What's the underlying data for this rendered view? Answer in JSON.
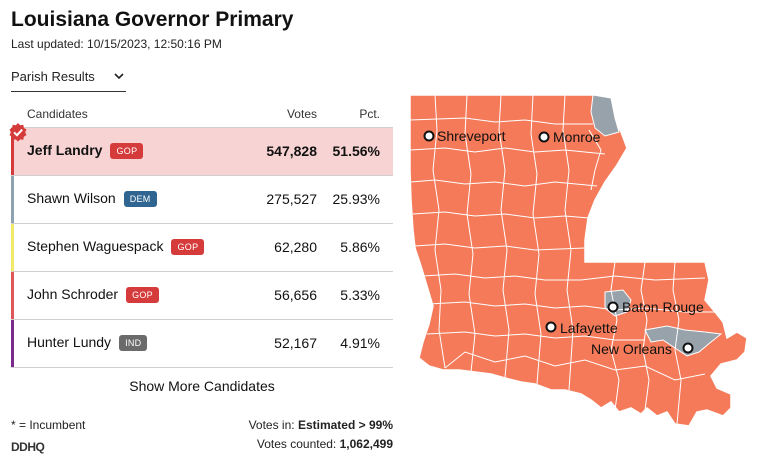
{
  "header": {
    "title": "Louisiana Governor Primary",
    "last_updated": "Last updated: 10/15/2023, 12:50:16 PM"
  },
  "view_selector": {
    "label": "Parish Results",
    "icon": "chevron-down-icon"
  },
  "table": {
    "headers": {
      "candidates": "Candidates",
      "votes": "Votes",
      "pct": "Pct."
    },
    "rows": [
      {
        "name": "Jeff Landry",
        "party": "GOP",
        "votes": "547,828",
        "pct": "51.56%",
        "party_color": "#d63b3b",
        "bar_color": "#d63b3b",
        "winner": true
      },
      {
        "name": "Shawn Wilson",
        "party": "DEM",
        "votes": "275,527",
        "pct": "25.93%",
        "party_color": "#2f6590",
        "bar_color": "#8fa2b0",
        "winner": false
      },
      {
        "name": "Stephen Waguespack",
        "party": "GOP",
        "votes": "62,280",
        "pct": "5.86%",
        "party_color": "#d63b3b",
        "bar_color": "#f2e968",
        "winner": false
      },
      {
        "name": "John Schroder",
        "party": "GOP",
        "votes": "56,656",
        "pct": "5.33%",
        "party_color": "#d63b3b",
        "bar_color": "#e0575a",
        "winner": false
      },
      {
        "name": "Hunter Lundy",
        "party": "IND",
        "votes": "52,167",
        "pct": "4.91%",
        "party_color": "#6b6b6b",
        "bar_color": "#7a2a8a",
        "winner": false
      }
    ],
    "show_more": "Show More Candidates"
  },
  "footer": {
    "incumbent_note": "* = Incumbent",
    "votes_in_label": "Votes in: ",
    "votes_in_value": "Estimated > 99%",
    "votes_counted_label": "Votes counted: ",
    "votes_counted_value": "1,062,499",
    "logo": "DDHQ"
  },
  "map": {
    "landry_color": "#f47a59",
    "wilson_color": "#97a2aa",
    "cities": [
      "Shreveport",
      "Monroe",
      "Baton Rouge",
      "Lafayette",
      "New Orleans"
    ]
  }
}
